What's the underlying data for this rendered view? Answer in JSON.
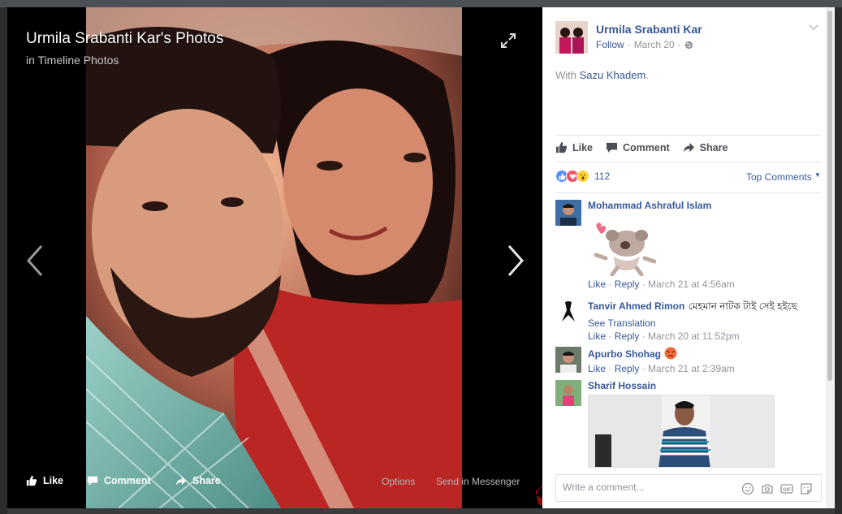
{
  "viewer": {
    "title": "Urmila Srabanti Kar's Photos",
    "subtitle": "in Timeline Photos",
    "bar": {
      "like": "Like",
      "comment": "Comment",
      "share": "Share",
      "options": "Options",
      "send": "Send in Messenger"
    }
  },
  "post": {
    "author": "Urmila Srabanti Kar",
    "follow": "Follow",
    "dot": "·",
    "date": "March 20",
    "body_prefix": "With",
    "tagged": "Sazu Khadem",
    "body_suffix": ".",
    "actions": {
      "like": "Like",
      "comment": "Comment",
      "share": "Share"
    },
    "reaction_count": "112",
    "top_comments": "Top Comments"
  },
  "comments": [
    {
      "name": "Mohammad Ashraful Islam",
      "text": "",
      "translation": "",
      "like": "Like",
      "reply": "Reply",
      "time": "March 21 at 4:56am"
    },
    {
      "name": "Tanvir Ahmed Rimon",
      "text": "মেহমান নাটক টাই সেই হইছে",
      "translation": "See Translation",
      "like": "Like",
      "reply": "Reply",
      "time": "March 20 at 11:52pm"
    },
    {
      "name": "Apurbo Shohag",
      "text": "",
      "translation": "",
      "like": "Like",
      "reply": "Reply",
      "time": "March 21 at 2:39am"
    },
    {
      "name": "Sharif Hossain",
      "text": "",
      "translation": "",
      "like": "",
      "reply": "",
      "time": ""
    }
  ],
  "composer": {
    "placeholder": "Write a comment..."
  },
  "colors": {
    "link": "#365899",
    "muted": "#90949c",
    "stage": "#000000",
    "redaction": "#8b0000"
  },
  "icons": {
    "expand": "expand-icon",
    "prev": "chevron-left-icon",
    "next": "chevron-right-icon",
    "like": "thumbs-up-icon",
    "comment": "comment-bubble-icon",
    "share": "share-arrow-icon",
    "globe": "globe-icon",
    "emoji": "emoji-icon",
    "camera": "camera-icon",
    "gif": "gif-icon",
    "sticker": "sticker-icon"
  }
}
